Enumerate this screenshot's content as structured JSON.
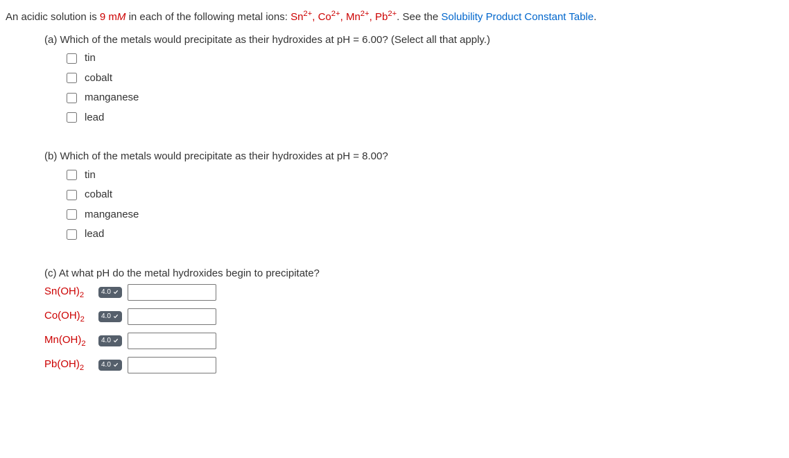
{
  "intro": {
    "prefix": "An acidic solution is ",
    "conc": "9 m",
    "conc_italic": "M",
    "mid": " in each of the following metal ions: ",
    "ions": [
      {
        "base": "Sn",
        "sup": "2+"
      },
      {
        "base": "Co",
        "sup": "2+"
      },
      {
        "base": "Mn",
        "sup": "2+"
      },
      {
        "base": "Pb",
        "sup": "2+"
      }
    ],
    "after_ions": ". See the ",
    "link": "Solubility Product Constant Table",
    "end": "."
  },
  "partA": {
    "label": "(a) Which of the metals would precipitate as their hydroxides at pH = 6.00? (Select all that apply.)",
    "options": [
      "tin",
      "cobalt",
      "manganese",
      "lead"
    ]
  },
  "partB": {
    "label": "(b) Which of the metals would precipitate as their hydroxides at pH = 8.00?",
    "options": [
      "tin",
      "cobalt",
      "manganese",
      "lead"
    ]
  },
  "partC": {
    "label": "(c) At what pH do the metal hydroxides begin to precipitate?",
    "rows": [
      {
        "base": "Sn(OH)",
        "sub": "2",
        "badge": "4.0"
      },
      {
        "base": "Co(OH)",
        "sub": "2",
        "badge": "4.0"
      },
      {
        "base": "Mn(OH)",
        "sub": "2",
        "badge": "4.0"
      },
      {
        "base": "Pb(OH)",
        "sub": "2",
        "badge": "4.0"
      }
    ]
  }
}
